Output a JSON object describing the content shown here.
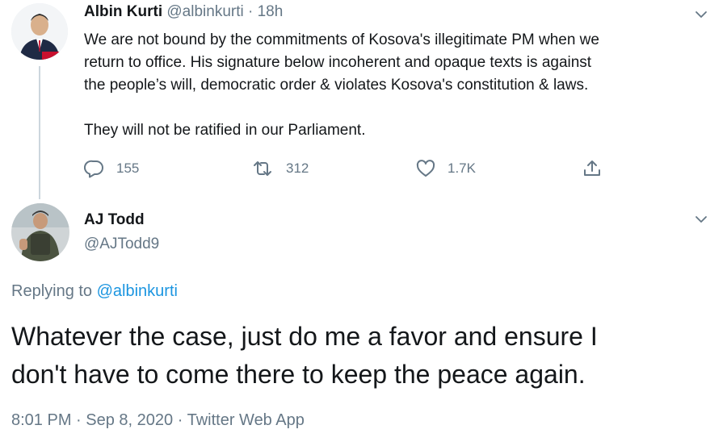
{
  "colors": {
    "text": "#14171a",
    "muted": "#657786",
    "link": "#1b95e0",
    "thread_line": "#ccd6dd"
  },
  "tweet": {
    "author_name": "Albin Kurti",
    "handle": "@albinkurti",
    "separator": "·",
    "time": "18h",
    "text_lines": [
      "We are not bound by the commitments of Kosova's illegitimate PM when we",
      "return to office. His signature below incoherent and opaque texts is against",
      "the people’s will, democratic order & violates Kosova's constitution & laws.",
      "They will not be ratified in our Parliament."
    ],
    "actions": {
      "reply_icon": "reply-icon",
      "reply_count": "155",
      "retweet_icon": "retweet-icon",
      "retweet_count": "312",
      "like_icon": "heart-icon",
      "like_count": "1.7K",
      "share_icon": "share-icon"
    },
    "caret_icon": "chevron-down-icon"
  },
  "reply": {
    "author_name": "AJ Todd",
    "handle": "@AJTodd9",
    "replying_prefix": "Replying to",
    "replying_to": "@albinkurti",
    "text_lines": [
      "Whatever the case, just do me a favor and ensure I",
      "don't have to come there to keep the peace again."
    ],
    "time": "8:01 PM",
    "separator1": "·",
    "date": "Sep 8, 2020",
    "separator2": "·",
    "app": "Twitter Web App",
    "caret_icon": "chevron-down-icon"
  }
}
